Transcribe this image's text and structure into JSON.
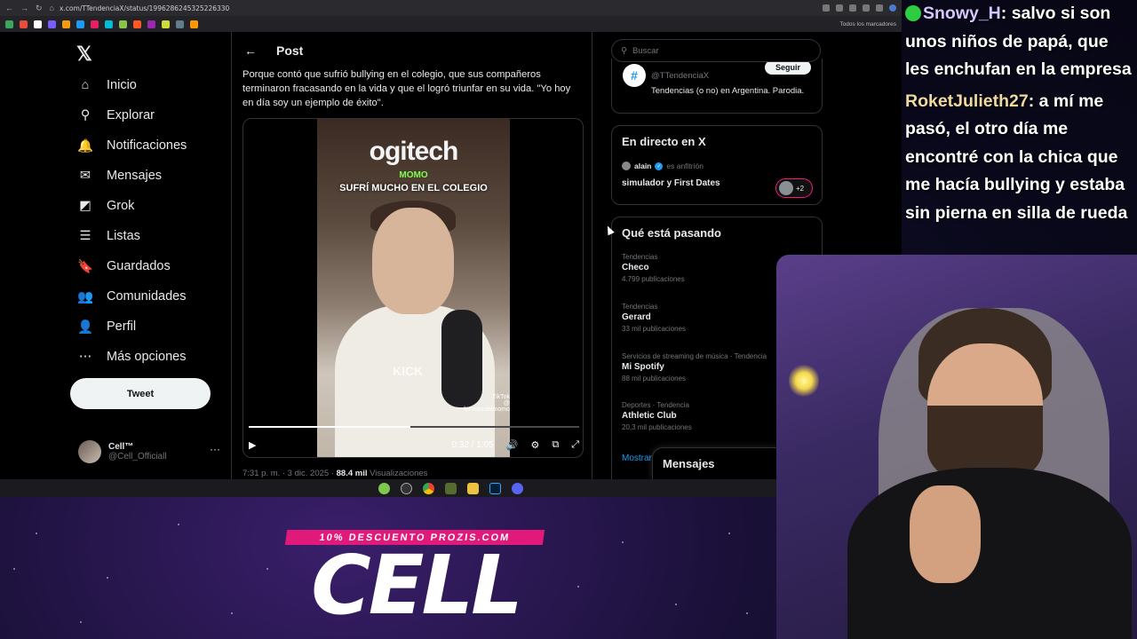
{
  "browser": {
    "url": "x.com/TTendenciaX/status/1996286245325226330",
    "bookmarks_label": "Todos los marcadores"
  },
  "sidebar": {
    "logo": "𝕏",
    "items": [
      {
        "label": "Inicio",
        "icon": "home-icon",
        "glyph": "⌂"
      },
      {
        "label": "Explorar",
        "icon": "search-icon",
        "glyph": "⚲"
      },
      {
        "label": "Notificaciones",
        "icon": "bell-icon",
        "glyph": "🔔"
      },
      {
        "label": "Mensajes",
        "icon": "mail-icon",
        "glyph": "✉"
      },
      {
        "label": "Grok",
        "icon": "grok-icon",
        "glyph": "◩"
      },
      {
        "label": "Listas",
        "icon": "list-icon",
        "glyph": "☰"
      },
      {
        "label": "Guardados",
        "icon": "bookmark-icon",
        "glyph": "🔖"
      },
      {
        "label": "Comunidades",
        "icon": "communities-icon",
        "glyph": "👥"
      },
      {
        "label": "Perfil",
        "icon": "profile-icon",
        "glyph": "👤"
      },
      {
        "label": "Más opciones",
        "icon": "more-icon",
        "glyph": "⋯"
      }
    ],
    "tweet_button": "Tweet",
    "account": {
      "name": "Cell™",
      "handle": "@Cell_Officiall",
      "more": "···"
    }
  },
  "post": {
    "back": "←",
    "title": "Post",
    "text": "Porque contó que sufrió bullying en el colegio, que sus compañeros terminaron fracasando en la vida y que el logró triunfar en su vida. \"Yo hoy en día soy un ejemplo de éxito\".",
    "video": {
      "brand": "ogitech",
      "caption_top": "MOMO",
      "caption": "SUFRÍ MUCHO EN EL COLEGIO",
      "watermark": "KICK",
      "tiktok": "TikTok",
      "tiktok_handle": "@ lomejordelmomo",
      "time": "0:32 / 1:05",
      "progress": 0.49
    },
    "meta_time": "7:31 p. m. · 3 dic. 2025 ·",
    "views_count": "88.4 mil",
    "views_label": "Visualizaciones"
  },
  "right": {
    "search_placeholder": "Buscar",
    "profile_card": {
      "handle": "@TTendenciaX",
      "bio": "Tendencias (o no) en Argentina. Parodia.",
      "follow": "Seguir"
    },
    "live": {
      "title": "En directo en X",
      "host_name": "alain",
      "host_suffix": "es anfitrión",
      "space_title": "simulador y First Dates",
      "listeners": "+2"
    },
    "trends": {
      "title": "Qué está pasando",
      "items": [
        {
          "category": "Tendencias",
          "name": "Checo",
          "count": "4.799 publicaciones"
        },
        {
          "category": "Tendencias",
          "name": "Gerard",
          "count": "33 mil publicaciones"
        },
        {
          "category": "Servicios de streaming de música · Tendencia",
          "name": "Mi Spotify",
          "count": "88 mil publicaciones"
        },
        {
          "category": "Deportes · Tendencia",
          "name": "Athletic Club",
          "count": "20,3 mil publicaciones"
        }
      ],
      "show_more": "Mostrar"
    },
    "messages_dock": "Mensajes"
  },
  "chat": {
    "messages": [
      {
        "user": "Snowy_H",
        "user_color": "#d6c6ff",
        "text": ": salvo si son unos niños de papá, que les enchufan en la empresa"
      },
      {
        "user": "RoketJulieth27",
        "user_color": "#f0d9a0",
        "text": ": a mí me pasó, el otro día me encontré con la chica que me hacía bullying y estaba sin pierna en silla de rueda"
      }
    ]
  },
  "overlay": {
    "promo": "10% DESCUENTO PROZIS.COM",
    "brand": "CELL"
  },
  "colors": {
    "accent": "#1d9bf0",
    "promo": "#e0197a",
    "background": "#000000"
  }
}
